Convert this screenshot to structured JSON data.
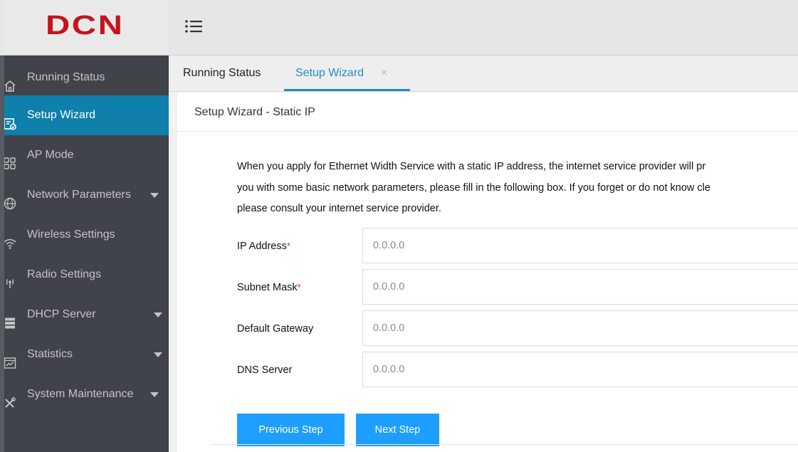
{
  "header": {
    "logo_text": "DCN",
    "menu_icon": "list-menu-icon",
    "brand_color": "#c7121b"
  },
  "sidebar": {
    "items": [
      {
        "label": "Running Status",
        "icon": "home-icon",
        "active": false,
        "has_caret": false
      },
      {
        "label": "Setup Wizard",
        "icon": "wizard-icon",
        "active": true,
        "has_caret": false
      },
      {
        "label": "AP Mode",
        "icon": "ap-grid-icon",
        "active": false,
        "has_caret": false
      },
      {
        "label": "Network Parameters",
        "icon": "globe-icon",
        "active": false,
        "has_caret": true
      },
      {
        "label": "Wireless Settings",
        "icon": "wifi-icon",
        "active": false,
        "has_caret": false
      },
      {
        "label": "Radio Settings",
        "icon": "radio-icon",
        "active": false,
        "has_caret": false
      },
      {
        "label": "DHCP Server",
        "icon": "server-icon",
        "active": false,
        "has_caret": true
      },
      {
        "label": "Statistics",
        "icon": "chart-icon",
        "active": false,
        "has_caret": true
      },
      {
        "label": "System Maintenance",
        "icon": "tools-icon",
        "active": false,
        "has_caret": true
      }
    ],
    "active_color": "#0f7fab",
    "background_color": "#404349"
  },
  "tabs": [
    {
      "label": "Running Status",
      "active": false
    },
    {
      "label": "Setup Wizard",
      "active": true,
      "closable": true,
      "close_glyph": "×"
    }
  ],
  "panel": {
    "title": "Setup Wizard - Static IP",
    "description_lines": [
      "When you apply for Ethernet Width Service with a static IP address, the internet service provider will pr",
      "you with some basic network parameters, please fill in the following box. If you forget or do not know cle",
      "please consult your internet service provider."
    ],
    "fields": [
      {
        "label": "IP Address",
        "required": true,
        "placeholder": "0.0.0.0",
        "value": ""
      },
      {
        "label": "Subnet Mask",
        "required": true,
        "placeholder": "0.0.0.0",
        "value": ""
      },
      {
        "label": "Default Gateway",
        "required": false,
        "placeholder": "0.0.0.0",
        "value": ""
      },
      {
        "label": "DNS Server",
        "required": false,
        "placeholder": "0.0.0.0",
        "value": ""
      }
    ],
    "required_marker": "*",
    "buttons": {
      "previous": "Previous Step",
      "next": "Next Step"
    },
    "button_color": "#1e9fff"
  }
}
